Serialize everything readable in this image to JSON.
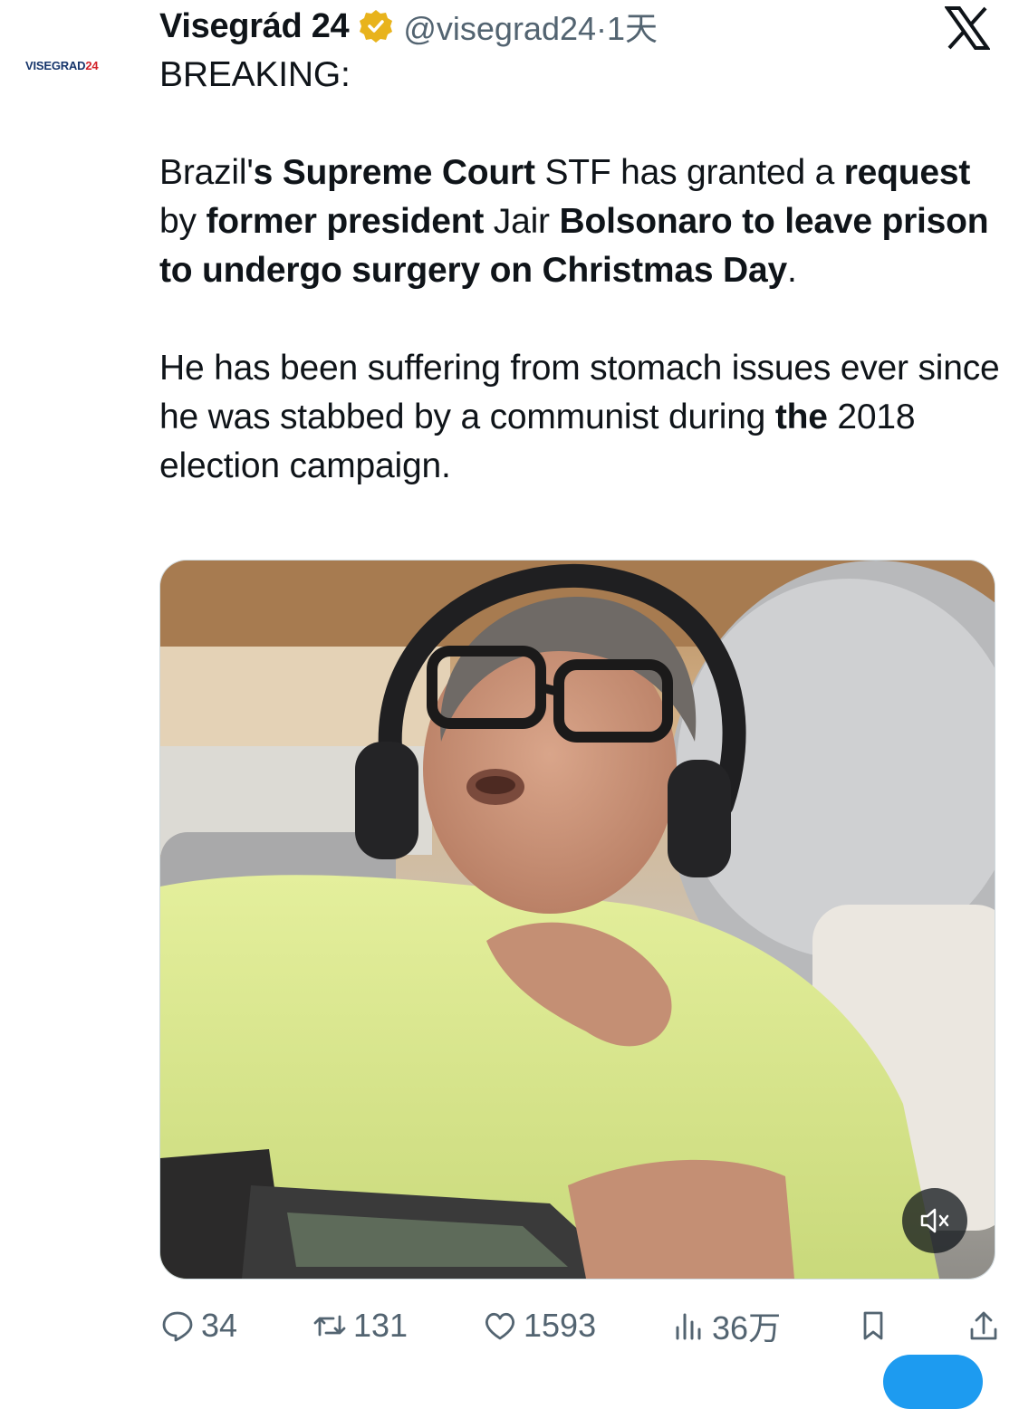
{
  "account": {
    "avatar_text_a": "VISEGRAD",
    "avatar_text_b": "24",
    "display_name": "Visegrád 24",
    "handle": "@visegrad24",
    "separator": "·",
    "time_ago": "1天",
    "verified_color": "#e8b31c"
  },
  "tweet": {
    "line1": "BREAKING:",
    "p2": [
      {
        "t": "Brazil'",
        "b": false
      },
      {
        "t": "s Supreme Court",
        "b": true
      },
      {
        "t": " STF has granted a ",
        "b": false
      },
      {
        "t": "request",
        "b": true
      },
      {
        "t": " by ",
        "b": false
      },
      {
        "t": "former president",
        "b": true
      },
      {
        "t": " Jair ",
        "b": false
      },
      {
        "t": "Bolsonaro to leave prison to undergo surgery on Christmas Day",
        "b": true
      },
      {
        "t": ".",
        "b": false
      }
    ],
    "p3": [
      {
        "t": "He has been suffering from stomach issues ever since he was stabbed by a communist during ",
        "b": false
      },
      {
        "t": "the",
        "b": true
      },
      {
        "t": " 2018 election campaign.",
        "b": false
      }
    ]
  },
  "media": {
    "mute_icon": "speaker-muted-icon"
  },
  "actions": {
    "replies": "34",
    "reposts": "131",
    "likes": "1593",
    "views": "36万",
    "accent_color": "#1d9bf0"
  }
}
